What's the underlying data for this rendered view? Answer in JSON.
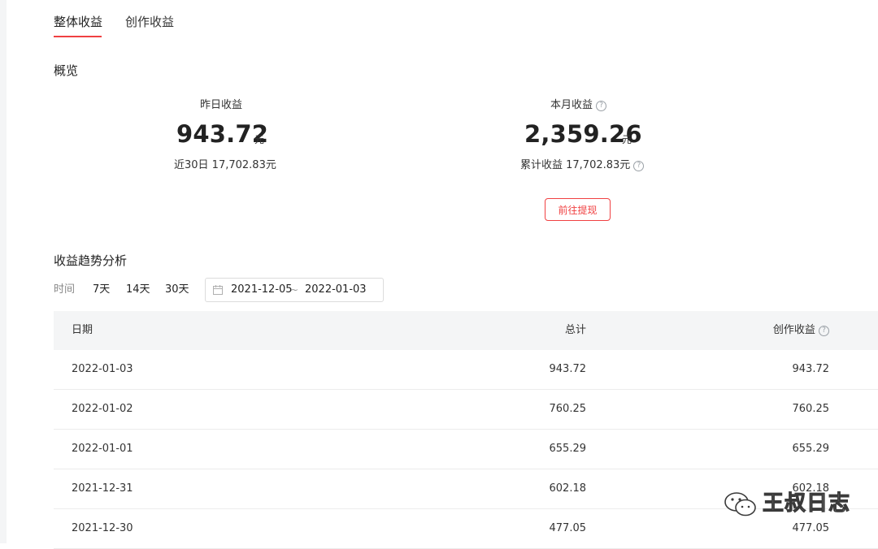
{
  "tabs": [
    {
      "label": "整体收益",
      "active": true
    },
    {
      "label": "创作收益",
      "active": false
    }
  ],
  "overview": {
    "title": "概览",
    "yesterday": {
      "label": "昨日收益",
      "value": "943.72",
      "unit": "元",
      "sub": "近30日 17,702.83元"
    },
    "month": {
      "label": "本月收益",
      "value": "2,359.26",
      "unit": "元",
      "sub": "累计收益 17,702.83元"
    },
    "withdraw_button": "前往提现"
  },
  "trend": {
    "title": "收益趋势分析",
    "time_label": "时间",
    "ranges": [
      "7天",
      "14天",
      "30天"
    ],
    "date_start": "2021-12-05",
    "date_sep": "~",
    "date_end": "2022-01-03"
  },
  "table": {
    "headers": {
      "date": "日期",
      "total": "总计",
      "creation": "创作收益"
    },
    "rows": [
      {
        "date": "2022-01-03",
        "total": "943.72",
        "creation": "943.72"
      },
      {
        "date": "2022-01-02",
        "total": "760.25",
        "creation": "760.25"
      },
      {
        "date": "2022-01-01",
        "total": "655.29",
        "creation": "655.29"
      },
      {
        "date": "2021-12-31",
        "total": "602.18",
        "creation": "602.18"
      },
      {
        "date": "2021-12-30",
        "total": "477.05",
        "creation": "477.05"
      }
    ]
  },
  "watermark": {
    "text": "王叔日志"
  },
  "colors": {
    "accent": "#f04142",
    "header_bg": "#f4f5f6"
  },
  "icons": [
    "help-circle-icon",
    "calendar-icon",
    "wechat-logo-icon"
  ]
}
